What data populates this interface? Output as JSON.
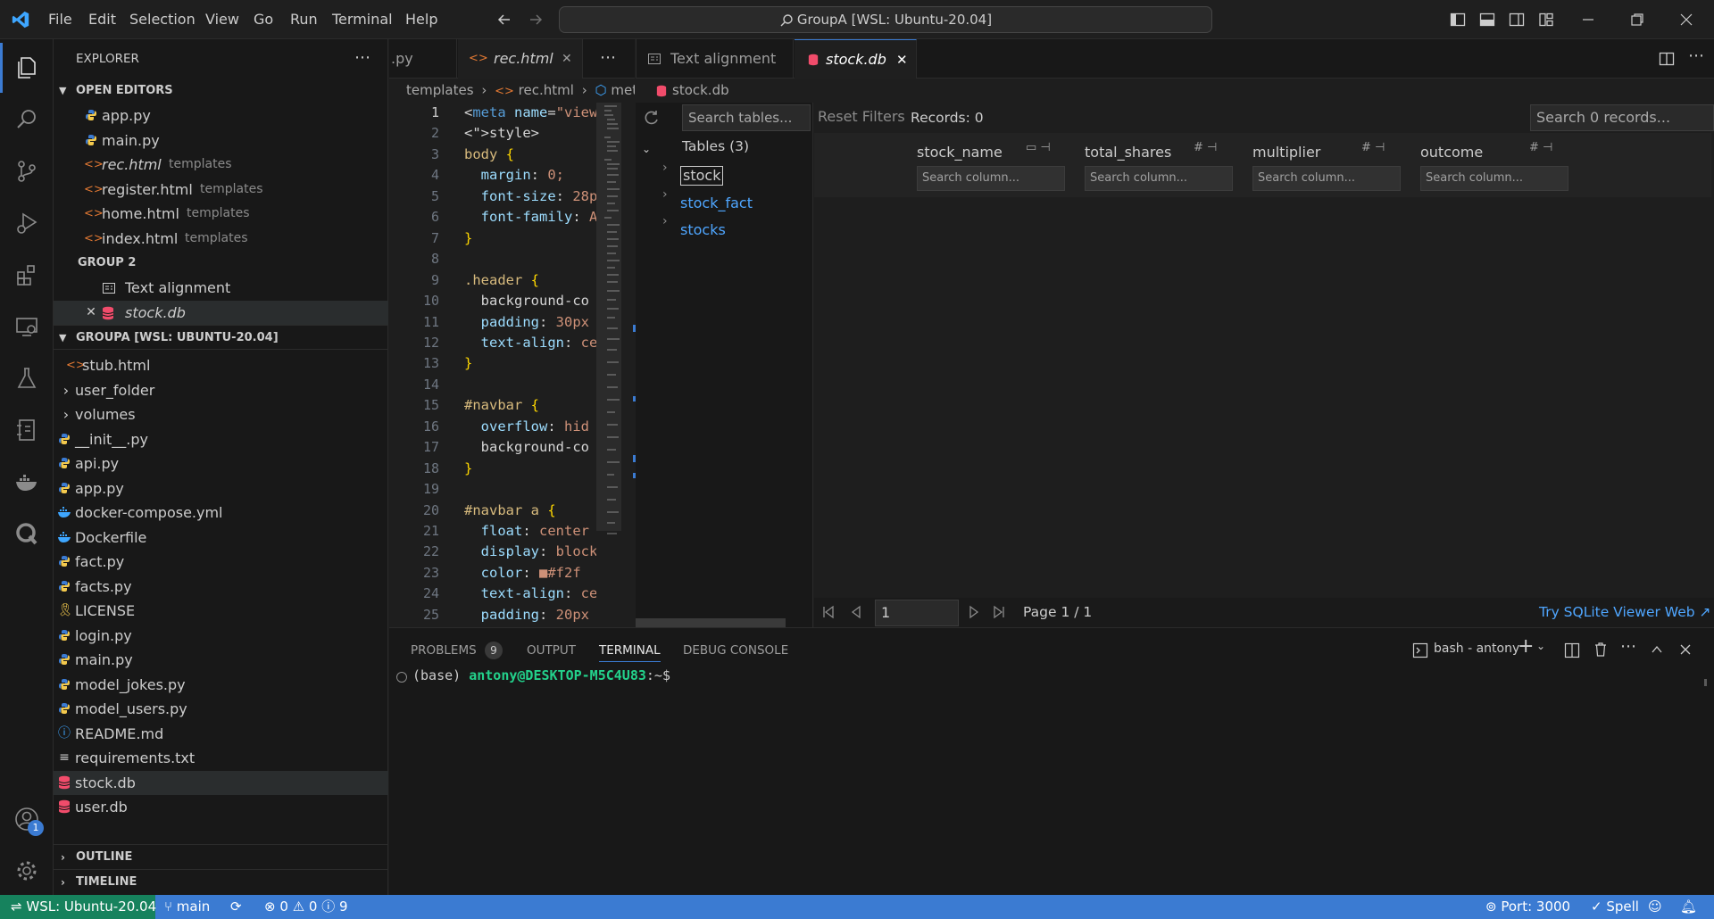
{
  "titlebar": {
    "menu": [
      "File",
      "Edit",
      "Selection",
      "View",
      "Go",
      "Run",
      "Terminal",
      "Help"
    ],
    "command_center": "GroupA [WSL: Ubuntu-20.04]"
  },
  "sidebar": {
    "title": "EXPLORER",
    "open_editors_header": "OPEN EDITORS",
    "open_editors": [
      {
        "name": "app.py",
        "hint": "",
        "icon": "python-icon"
      },
      {
        "name": "main.py",
        "hint": "",
        "icon": "python-icon"
      },
      {
        "name": "rec.html",
        "hint": "templates",
        "icon": "html-icon"
      },
      {
        "name": "register.html",
        "hint": "templates",
        "icon": "html-icon"
      },
      {
        "name": "home.html",
        "hint": "templates",
        "icon": "html-icon"
      },
      {
        "name": "index.html",
        "hint": "templates",
        "icon": "html-icon"
      }
    ],
    "group2_header": "GROUP 2",
    "group2": [
      {
        "name": "Text alignment",
        "icon": "preview-icon"
      },
      {
        "name": "stock.db",
        "icon": "database-icon"
      }
    ],
    "workspace_header": "GROUPA [WSL: UBUNTU-20.04]",
    "files": [
      {
        "name": "stub.html",
        "icon": "html-icon"
      },
      {
        "name": "user_folder",
        "icon": "chevron-right-icon"
      },
      {
        "name": "volumes",
        "icon": "chevron-right-icon"
      },
      {
        "name": "__init__.py",
        "icon": "python-icon"
      },
      {
        "name": "api.py",
        "icon": "python-icon"
      },
      {
        "name": "app.py",
        "icon": "python-icon"
      },
      {
        "name": "docker-compose.yml",
        "icon": "docker-icon"
      },
      {
        "name": "Dockerfile",
        "icon": "docker-icon"
      },
      {
        "name": "fact.py",
        "icon": "python-icon"
      },
      {
        "name": "facts.py",
        "icon": "python-icon"
      },
      {
        "name": "LICENSE",
        "icon": "license-icon"
      },
      {
        "name": "login.py",
        "icon": "python-icon"
      },
      {
        "name": "main.py",
        "icon": "python-icon"
      },
      {
        "name": "model_jokes.py",
        "icon": "python-icon"
      },
      {
        "name": "model_users.py",
        "icon": "python-icon"
      },
      {
        "name": "README.md",
        "icon": "info-icon"
      },
      {
        "name": "requirements.txt",
        "icon": "text-icon"
      },
      {
        "name": "stock.db",
        "icon": "database-icon"
      },
      {
        "name": "user.db",
        "icon": "database-icon"
      }
    ],
    "outline": "OUTLINE",
    "timeline": "TIMELINE"
  },
  "editor1": {
    "tabs": [
      ".py",
      "rec.html"
    ],
    "breadcrumb": [
      "templates",
      "rec.html",
      "meta"
    ],
    "line_numbers": [
      "1",
      "2",
      "3",
      "4",
      "5",
      "6",
      "7",
      "8",
      "9",
      "10",
      "11",
      "12",
      "13",
      "14",
      "15",
      "16",
      "17",
      "18",
      "19",
      "20",
      "21",
      "22",
      "23",
      "24",
      "25"
    ],
    "lines": [
      "<meta name=\"view",
      "<style>",
      "body {",
      "  margin: 0;",
      "  font-size: 28p",
      "  font-family: A",
      "}",
      "",
      ".header {",
      "  background-co",
      "  padding: 30px",
      "  text-align: ce",
      "}",
      "",
      "#navbar {",
      "  overflow: hid",
      "  background-co",
      "}",
      "",
      "#navbar a {",
      "  float: center",
      "  display: block",
      "  color: ■#f2f",
      "  text-align: ce",
      "  padding: 20px"
    ]
  },
  "editor2": {
    "tabs": [
      "Text alignment",
      "stock.db"
    ],
    "breadcrumb": "stock.db",
    "search_tables_placeholder": "Search tables...",
    "reset_filters": "Reset Filters",
    "records": "Records: 0",
    "search_records_placeholder": "Search 0 records...",
    "tables_header": "Tables (3)",
    "tables": [
      "stock",
      "stock_fact",
      "stocks"
    ],
    "columns": [
      "stock_name",
      "total_shares",
      "multiplier",
      "outcome"
    ],
    "column_search_placeholder": "Search column...",
    "page_input": "1",
    "page_label": "Page 1 / 1",
    "try_link": "Try SQLite Viewer Web ↗"
  },
  "panel": {
    "tabs": [
      "PROBLEMS",
      "OUTPUT",
      "TERMINAL",
      "DEBUG CONSOLE"
    ],
    "problems_count": "9",
    "terminal_name": "bash - antony",
    "prompt_env": "(base)",
    "prompt_user": "antony@DESKTOP-M5C4U83",
    "prompt_tail": ":~$"
  },
  "statusbar": {
    "remote": "WSL: Ubuntu-20.04",
    "branch": "main",
    "errors": "0",
    "warnings": "0",
    "infos": "9",
    "port": "Port: 3000",
    "spell": "Spell"
  },
  "activity": {
    "account_badge": "1"
  },
  "colors": {
    "accent": "#3b7bd2",
    "link": "#4fa6ff",
    "terminal_user": "#23d18b",
    "db_icon": "#f14c6b"
  }
}
